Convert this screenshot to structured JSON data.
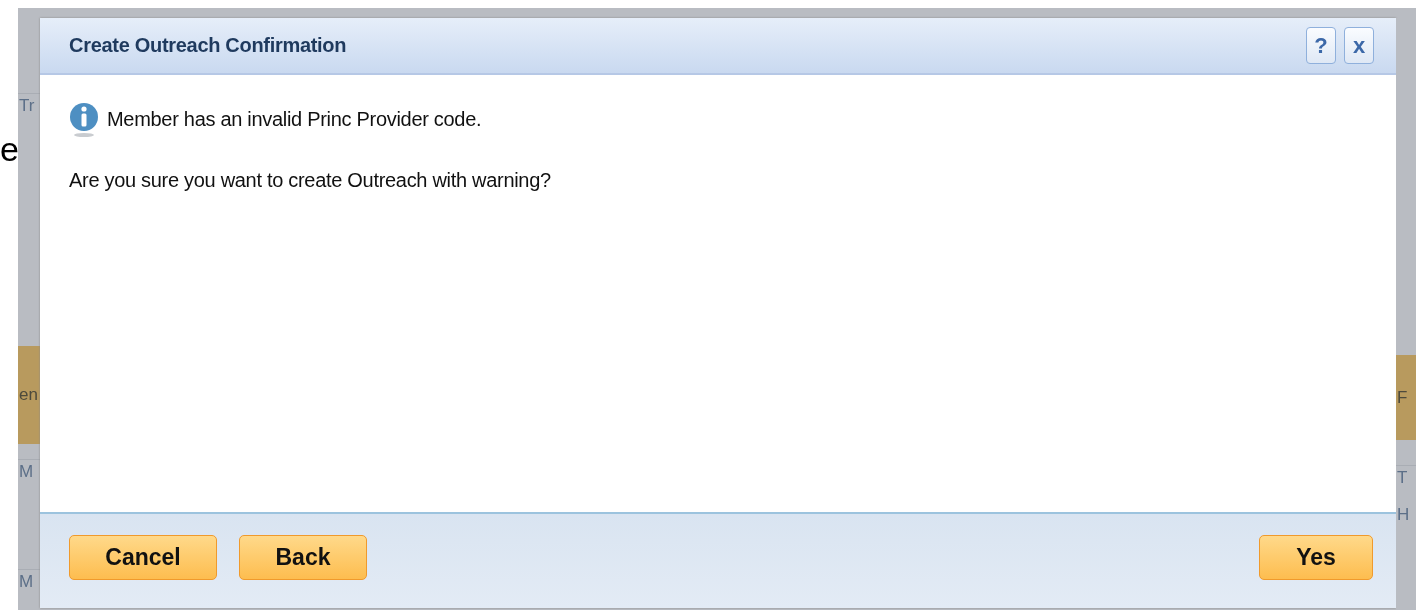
{
  "page_fragment": "e",
  "background_left": [
    {
      "kind": "row",
      "text": "Tr"
    },
    {
      "kind": "header",
      "text": "en"
    },
    {
      "kind": "row",
      "text": "M"
    },
    {
      "kind": "row",
      "text": "M"
    }
  ],
  "background_right": [
    {
      "kind": "header",
      "text": "F"
    },
    {
      "kind": "row",
      "text": "T"
    },
    {
      "kind": "row",
      "text": "H"
    }
  ],
  "dialog": {
    "title": "Create Outreach Confirmation",
    "help": "?",
    "close": "x",
    "message": "Member has an invalid Princ Provider code.",
    "question": "Are you sure you want to create Outreach with warning?",
    "buttons": [
      {
        "label": "Cancel",
        "kind": "left"
      },
      {
        "label": "Back",
        "kind": "left"
      },
      {
        "label": "Yes",
        "kind": "right"
      }
    ]
  }
}
